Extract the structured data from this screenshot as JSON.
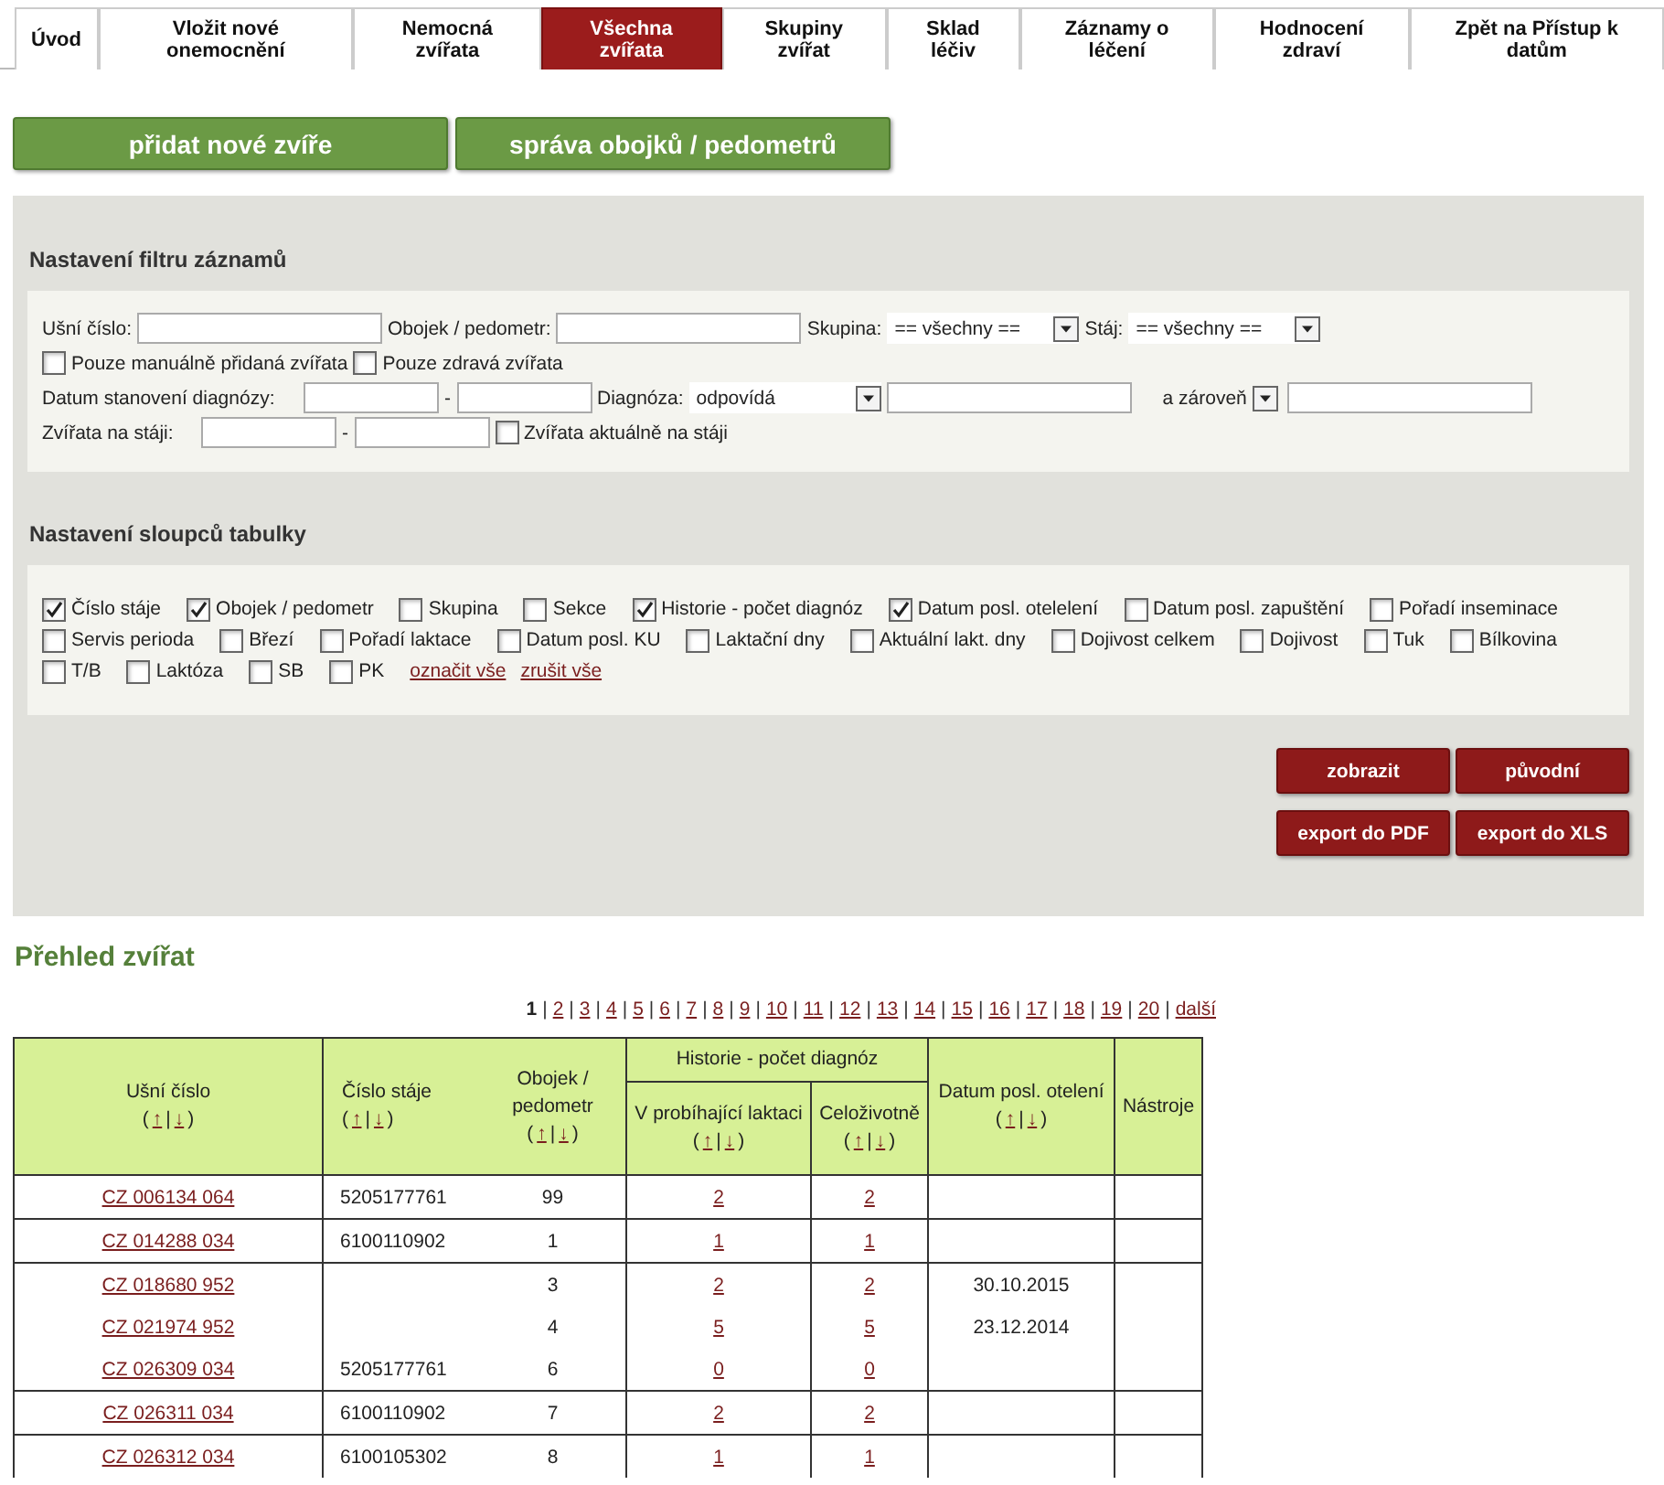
{
  "tabs": [
    {
      "label": "Úvod",
      "selected": false
    },
    {
      "label": "Vložit nové onemocnění",
      "selected": false
    },
    {
      "label": "Nemocná zvířata",
      "selected": false
    },
    {
      "label": "Všechna zvířata",
      "selected": true
    },
    {
      "label": "Skupiny zvířat",
      "selected": false
    },
    {
      "label": "Sklad léčiv",
      "selected": false
    },
    {
      "label": "Záznamy o léčení",
      "selected": false
    },
    {
      "label": "Hodnocení zdraví",
      "selected": false
    },
    {
      "label": "Zpět na Přístup k datům",
      "selected": false
    }
  ],
  "action_buttons": [
    "přidat nové zvíře",
    "správa obojků / pedometrů"
  ],
  "filter": {
    "title": "Nastavení filtru záznamů",
    "rows": [
      [
        {
          "kind": "label",
          "text": "Ušní číslo:"
        },
        {
          "kind": "wide-input"
        },
        {
          "kind": "label",
          "text": "Obojek / pedometr:"
        },
        {
          "kind": "wide-input"
        },
        {
          "kind": "label",
          "text": "Skupina:"
        },
        {
          "kind": "select",
          "value": "== všechny =="
        },
        {
          "kind": "label",
          "text": "Stáj:"
        },
        {
          "kind": "select",
          "value": "== všechny =="
        }
      ],
      [
        {
          "kind": "checkbox",
          "text": "Pouze manuálně přidaná zvířata",
          "checked": false
        },
        {
          "kind": "checkbox",
          "text": "Pouze zdravá zvířata",
          "checked": false
        }
      ],
      [
        {
          "kind": "label",
          "text": "Datum stanovení diagnózy:"
        },
        {
          "kind": "narrow-input"
        },
        {
          "kind": "label",
          "text": "-"
        },
        {
          "kind": "narrow-input"
        },
        {
          "kind": "label",
          "text": "Diagnóza:"
        },
        {
          "kind": "select",
          "value": "odpovídá"
        },
        {
          "kind": "wide-input"
        },
        {
          "kind": "label",
          "text": "a zároveň"
        },
        {
          "kind": "select"
        },
        {
          "kind": "wide-input"
        }
      ],
      [
        {
          "kind": "label",
          "text": "Zvířata na stáji:"
        },
        {
          "kind": "narrow-input"
        },
        {
          "kind": "label",
          "text": "-"
        },
        {
          "kind": "narrow-input"
        },
        {
          "kind": "checkbox",
          "text": "Zvířata aktuálně na stáji",
          "checked": false
        }
      ]
    ]
  },
  "columns_settings": {
    "title": "Nastavení sloupců tabulky",
    "options": [
      {
        "label": "Číslo stáje",
        "checked": true
      },
      {
        "label": "Obojek / pedometr",
        "checked": true
      },
      {
        "label": "Skupina",
        "checked": false
      },
      {
        "label": "Sekce",
        "checked": false
      },
      {
        "label": "Historie - počet diagnóz",
        "checked": true
      },
      {
        "label": "Datum posl. otelelení",
        "checked": true
      },
      {
        "label": "Datum posl. zapuštění",
        "checked": false
      },
      {
        "label": "Pořadí inseminace",
        "checked": false
      },
      {
        "label": "Servis perioda",
        "checked": false
      },
      {
        "label": "Březí",
        "checked": false
      },
      {
        "label": "Pořadí laktace",
        "checked": false
      },
      {
        "label": "Datum posl. KU",
        "checked": false
      },
      {
        "label": "Laktační dny",
        "checked": false
      },
      {
        "label": "Aktuální lakt. dny",
        "checked": false
      },
      {
        "label": "Dojivost celkem",
        "checked": false
      },
      {
        "label": "Dojivost",
        "checked": false
      },
      {
        "label": "Tuk",
        "checked": false
      },
      {
        "label": "Bílkovina",
        "checked": false
      },
      {
        "label": "T/B",
        "checked": false
      },
      {
        "label": "Laktóza",
        "checked": false
      },
      {
        "label": "SB",
        "checked": false
      },
      {
        "label": "PK",
        "checked": false
      }
    ],
    "links": [
      "označit vše",
      "zrušit vše"
    ]
  },
  "panel_buttons": [
    "zobrazit",
    "původní",
    "export do PDF",
    "export do XLS"
  ],
  "overview": {
    "title": "Přehled zvířat",
    "pages": [
      {
        "label": "1",
        "selected": true
      },
      {
        "label": "2",
        "selected": false
      },
      {
        "label": "3",
        "selected": false
      },
      {
        "label": "4",
        "selected": false
      },
      {
        "label": "5",
        "selected": false
      },
      {
        "label": "6",
        "selected": false
      },
      {
        "label": "7",
        "selected": false
      },
      {
        "label": "8",
        "selected": false
      },
      {
        "label": "9",
        "selected": false
      },
      {
        "label": "10",
        "selected": false
      },
      {
        "label": "11",
        "selected": false
      },
      {
        "label": "12",
        "selected": false
      },
      {
        "label": "13",
        "selected": false
      },
      {
        "label": "14",
        "selected": false
      },
      {
        "label": "15",
        "selected": false
      },
      {
        "label": "16",
        "selected": false
      },
      {
        "label": "17",
        "selected": false
      },
      {
        "label": "18",
        "selected": false
      },
      {
        "label": "19",
        "selected": false
      },
      {
        "label": "20",
        "selected": false
      }
    ],
    "next": "další",
    "separator": "|"
  },
  "table": {
    "columns": [
      {
        "label": "Ušní číslo",
        "sort": [
          "(",
          "↑",
          "|",
          "↓",
          ")"
        ]
      },
      {
        "label": "Číslo stáje",
        "sort": [
          "(",
          "↑",
          "|",
          "↓",
          ")"
        ]
      },
      {
        "label": "Obojek / pedometr",
        "sort": [
          "(",
          "↑",
          "|",
          "↓",
          ")"
        ]
      },
      {
        "label": "Historie - počet diagnóz",
        "children": [
          {
            "label": "V probíhající laktaci",
            "sort": [
              "(",
              "↑",
              "|",
              "↓",
              ")"
            ]
          },
          {
            "label": "Celoživotně",
            "sort": [
              "(",
              "↑",
              "|",
              "↓",
              ")"
            ]
          }
        ]
      },
      {
        "label": "Datum posl. otelení",
        "sort": [
          "(",
          "↑",
          "|",
          "↓",
          ")"
        ]
      },
      {
        "label": "Nástroje"
      }
    ],
    "groups": [
      [
        {
          "ear": "CZ 006134 064",
          "stable": "5205177761",
          "collar": "99",
          "current": "2",
          "lifetime": "2"
        }
      ],
      [
        {
          "ear": "CZ 014288 034",
          "stable": "6100110902",
          "collar": "1",
          "current": "1",
          "lifetime": "1"
        }
      ],
      [
        {
          "ear": "CZ 018680 952",
          "collar": "3",
          "current": "2",
          "lifetime": "2",
          "calving": "30.10.2015"
        },
        {
          "ear": "CZ 021974 952",
          "collar": "4",
          "current": "5",
          "lifetime": "5",
          "calving": "23.12.2014"
        },
        {
          "ear": "CZ 026309 034",
          "stable": "5205177761",
          "collar": "6",
          "current": "0",
          "lifetime": "0"
        }
      ],
      [
        {
          "ear": "CZ 026311 034",
          "stable": "6100110902",
          "collar": "7",
          "current": "2",
          "lifetime": "2"
        }
      ],
      [
        {
          "ear": "CZ 026312 034",
          "stable": "6100105302",
          "collar": "8",
          "current": "1",
          "lifetime": "1"
        }
      ]
    ]
  }
}
